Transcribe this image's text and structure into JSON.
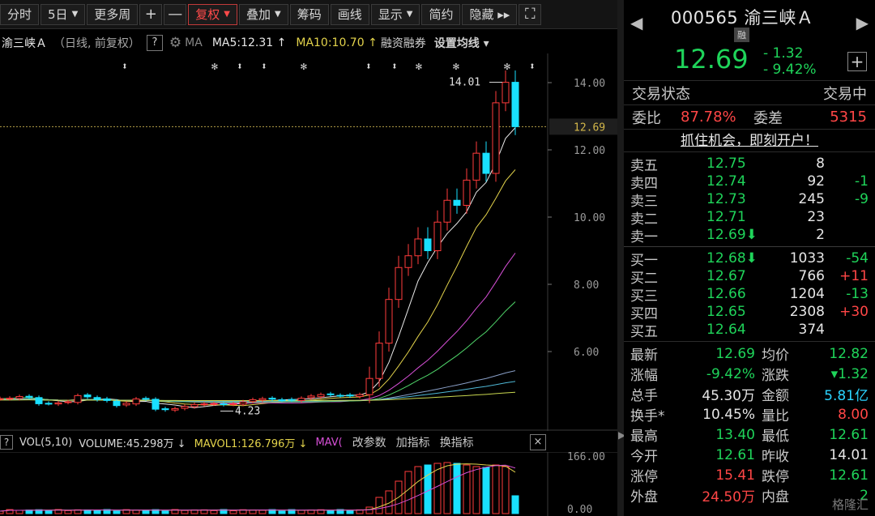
{
  "toolbar": {
    "items": [
      {
        "label": "分时",
        "caret": false
      },
      {
        "label": "5日",
        "caret": true
      },
      {
        "label": "更多周",
        "caret": false
      },
      {
        "label": "+",
        "caret": false
      },
      {
        "label": "—",
        "caret": false
      },
      {
        "label": "复权",
        "caret": true,
        "active": true
      },
      {
        "label": "叠加",
        "caret": true
      },
      {
        "label": "筹码",
        "caret": false
      },
      {
        "label": "画线",
        "caret": false
      },
      {
        "label": "显示",
        "caret": true
      },
      {
        "label": "简约",
        "caret": false
      },
      {
        "label": "隐藏 ▸▸",
        "caret": false
      },
      {
        "label": "⛶",
        "caret": false
      }
    ]
  },
  "chart_header": {
    "stock": "渝三峡Ａ",
    "period": "（日线, 前复权）",
    "q": "?",
    "ma_label": "MA",
    "ma5": "MA5:12.31 ↑",
    "ma10": "MA10:10.70 ↑",
    "rzrq": "融资融券",
    "set_ma": "设置均线 ▾"
  },
  "chart_data": {
    "type": "candlestick",
    "y_ticks": [
      "14.00",
      "12.00",
      "10.00",
      "8.00",
      "6.00"
    ],
    "y_tick_values": [
      14,
      12,
      10,
      8,
      6
    ],
    "current_price_label": "12.69",
    "current_price": 12.69,
    "high_annotation": "14.01",
    "low_annotation": "4.23",
    "high_value": 14.01,
    "low_value": 4.23,
    "ma5_last": 12.31,
    "ma10_last": 10.7
  },
  "volume": {
    "q": "?",
    "label": "VOL(5,10)",
    "volume": "VOLUME:45.298万 ↓",
    "mavol1": "MAVOL1:126.796万 ↓",
    "mavol2": "MAV(",
    "opt1": "改参数",
    "opt2": "加指标",
    "opt3": "换指标",
    "close": "×",
    "y_ticks": [
      "166.00",
      "0.00"
    ]
  },
  "panel": {
    "code": "000565 渝三峡Ａ",
    "rong": "融",
    "price": "12.69",
    "chg_abs": "- 1.32",
    "chg_pct": "- 9.42%",
    "plus": "+",
    "trade_status_label": "交易状态",
    "trade_status_value": "交易中",
    "weibi_label": "委比",
    "weibi_value": "87.78%",
    "weicha_label": "委差",
    "weicha_value": "5315",
    "promo": "抓住机会，即刻开户！",
    "sell": [
      {
        "name": "卖五",
        "price": "12.75",
        "qty": "8",
        "delta": ""
      },
      {
        "name": "卖四",
        "price": "12.74",
        "qty": "92",
        "delta": "-1"
      },
      {
        "name": "卖三",
        "price": "12.73",
        "qty": "245",
        "delta": "-9"
      },
      {
        "name": "卖二",
        "price": "12.71",
        "qty": "23",
        "delta": ""
      },
      {
        "name": "卖一",
        "price": "12.69⬇",
        "qty": "2",
        "delta": ""
      }
    ],
    "buy": [
      {
        "name": "买一",
        "price": "12.68⬇",
        "qty": "1033",
        "delta": "-54"
      },
      {
        "name": "买二",
        "price": "12.67",
        "qty": "766",
        "delta": "+11"
      },
      {
        "name": "买三",
        "price": "12.66",
        "qty": "1204",
        "delta": "-13"
      },
      {
        "name": "买四",
        "price": "12.65",
        "qty": "2308",
        "delta": "+30"
      },
      {
        "name": "买五",
        "price": "12.64",
        "qty": "374",
        "delta": ""
      }
    ],
    "stats": [
      {
        "n1": "最新",
        "v1": "12.69",
        "c1": "grn",
        "n2": "均价",
        "v2": "12.82",
        "c2": "grn"
      },
      {
        "n1": "涨幅",
        "v1": "-9.42%",
        "c1": "grn",
        "n2": "涨跌",
        "v2": "▾1.32",
        "c2": "grn"
      },
      {
        "n1": "总手",
        "v1": "45.30万",
        "c1": "wht",
        "n2": "金额",
        "v2": "5.81亿",
        "c2": "cyn"
      },
      {
        "n1": "换手*",
        "v1": "10.45%",
        "c1": "wht",
        "n2": "量比",
        "v2": "8.00",
        "c2": "red"
      },
      {
        "n1": "最高",
        "v1": "13.40",
        "c1": "grn",
        "n2": "最低",
        "v2": "12.61",
        "c2": "grn"
      },
      {
        "n1": "今开",
        "v1": "12.61",
        "c1": "grn",
        "n2": "昨收",
        "v2": "14.01",
        "c2": "wht"
      },
      {
        "n1": "涨停",
        "v1": "15.41",
        "c1": "red",
        "n2": "跌停",
        "v2": "12.61",
        "c2": "grn"
      },
      {
        "n1": "外盘",
        "v1": "24.50万",
        "c1": "red",
        "n2": "内盘",
        "v2": "2",
        "c2": "grn"
      }
    ],
    "watermark": "格隆汇"
  }
}
